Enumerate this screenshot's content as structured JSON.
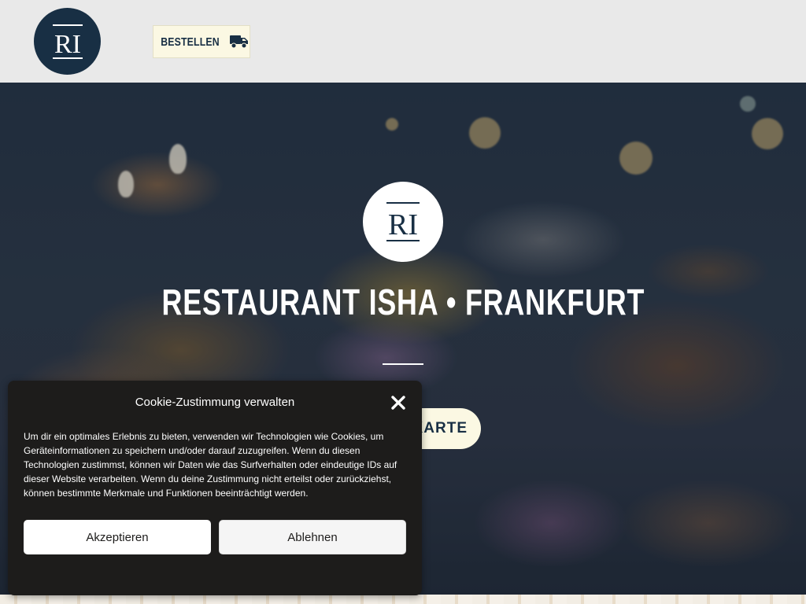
{
  "header": {
    "logo_text": "RI",
    "order_label": "BESTELLEN",
    "order_icon": "truck-icon"
  },
  "hero": {
    "logo_text": "RI",
    "title": "RESTAURANT ISHA • FRANKFURT",
    "menu_button_label": "KARTE"
  },
  "cookie": {
    "title": "Cookie-Zustimmung verwalten",
    "close_icon": "close-icon",
    "text": "Um dir ein optimales Erlebnis zu bieten, verwenden wir Technologien wie Cookies, um Geräteinformationen zu speichern und/oder darauf zuzugreifen. Wenn du diesen Technologien zustimmst, können wir Daten wie das Surfverhalten oder eindeutige IDs auf dieser Website verarbeiten. Wenn du deine Zustimmung nicht erteilst oder zurückziehst, können bestimmte Merkmale und Funktionen beeinträchtigt werden.",
    "accept_label": "Akzeptieren",
    "decline_label": "Ablehnen"
  },
  "colors": {
    "brand_navy": "#182f44",
    "button_cream": "#fbf8e3",
    "dialog_bg": "#1d1c1b"
  }
}
